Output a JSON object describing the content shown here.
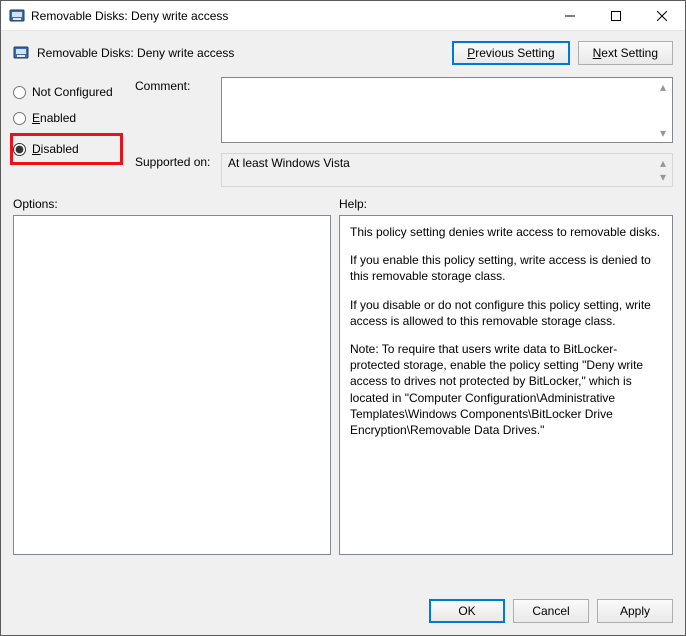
{
  "window": {
    "title": "Removable Disks: Deny write access"
  },
  "header": {
    "subtitle": "Removable Disks: Deny write access"
  },
  "nav": {
    "prev_prefix": "P",
    "prev_rest": "revious Setting",
    "next_prefix": "N",
    "next_rest": "ext Setting"
  },
  "radios": {
    "not_configured": "Not Configured",
    "enabled_prefix": "E",
    "enabled_rest": "nabled",
    "disabled_prefix": "D",
    "disabled_rest": "isabled",
    "selected": "disabled"
  },
  "fields": {
    "comment_label": "Comment:",
    "comment_value": "",
    "supported_label": "Supported on:",
    "supported_value": "At least Windows Vista"
  },
  "section_labels": {
    "options": "Options:",
    "help": "Help:"
  },
  "help_text": {
    "p1": "This policy setting denies write access to removable disks.",
    "p2": "If you enable this policy setting, write access is denied to this removable storage class.",
    "p3": "If you disable or do not configure this policy setting, write access is allowed to this removable storage class.",
    "p4": "Note: To require that users write data to BitLocker-protected storage, enable the policy setting \"Deny write access to drives not protected by BitLocker,\" which is located in \"Computer Configuration\\Administrative Templates\\Windows Components\\BitLocker Drive Encryption\\Removable Data Drives.\""
  },
  "footer": {
    "ok": "OK",
    "cancel": "Cancel",
    "apply": "Apply"
  }
}
